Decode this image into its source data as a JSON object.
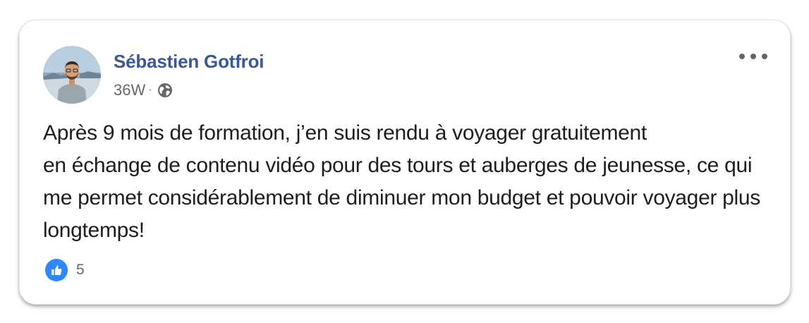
{
  "post": {
    "author": "Sébastien Gotfroi",
    "time": "36W",
    "separator": "·",
    "privacy_icon": "globe-icon",
    "more_icon": "ellipsis-icon",
    "text": {
      "part1": "Après 9 mois de formation, ",
      "highlight1": "j’en suis rendu à voyager gratuitement",
      "highlight2": "en échange de contenu vidéo",
      "part2": " pour des tours et auberges de jeunesse, ce qui me permet considérablement de diminuer mon budget et pouvoir voyager plus longtemps!"
    },
    "reactions": {
      "icon": "like-icon",
      "count": "5"
    }
  },
  "colors": {
    "author": "#385898",
    "meta": "#65676b",
    "text": "#1c1e21",
    "highlight": "#f3e700",
    "like": "#2d88ff"
  }
}
